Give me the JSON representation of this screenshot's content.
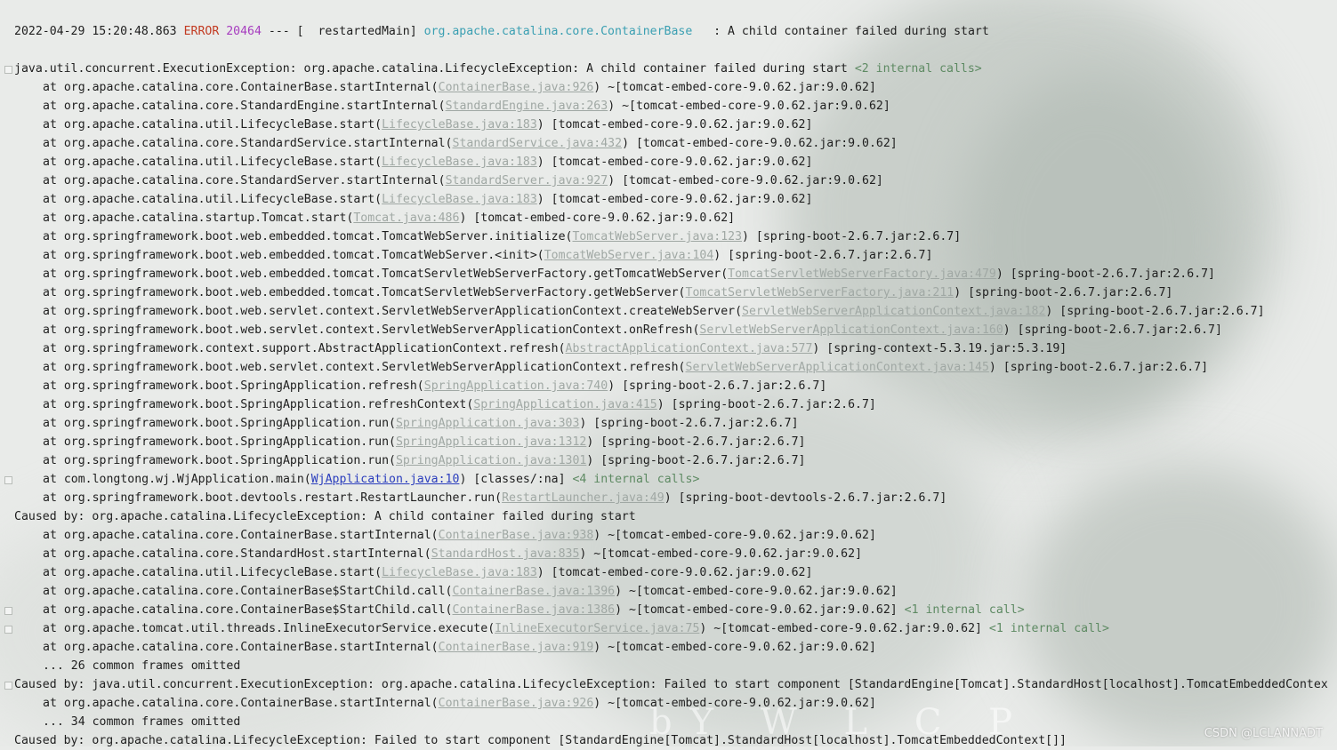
{
  "header_line": {
    "timestamp": "2022-04-29 15:20:48.863",
    "level": "ERROR",
    "pid": "20464",
    "sep": "---",
    "thread": "[  restartedMain]",
    "logger": "org.apache.catalina.core.ContainerBase",
    "message": ": A child container failed during start"
  },
  "stack_lines": [
    {
      "text": "java.util.concurrent.ExecutionException: org.apache.catalina.LifecycleException: A child container failed during start ",
      "internal": "<2 internal calls>",
      "fold": true
    },
    {
      "text": "at org.apache.catalina.core.ContainerBase.startInternal(",
      "link": "ContainerBase.java:926",
      "tail": ") ~[tomcat-embed-core-9.0.62.jar:9.0.62]",
      "indent": true
    },
    {
      "text": "at org.apache.catalina.core.StandardEngine.startInternal(",
      "link": "StandardEngine.java:263",
      "tail": ") ~[tomcat-embed-core-9.0.62.jar:9.0.62]",
      "indent": true
    },
    {
      "text": "at org.apache.catalina.util.LifecycleBase.start(",
      "link": "LifecycleBase.java:183",
      "tail": ") [tomcat-embed-core-9.0.62.jar:9.0.62]",
      "indent": true
    },
    {
      "text": "at org.apache.catalina.core.StandardService.startInternal(",
      "link": "StandardService.java:432",
      "tail": ") [tomcat-embed-core-9.0.62.jar:9.0.62]",
      "indent": true
    },
    {
      "text": "at org.apache.catalina.util.LifecycleBase.start(",
      "link": "LifecycleBase.java:183",
      "tail": ") [tomcat-embed-core-9.0.62.jar:9.0.62]",
      "indent": true
    },
    {
      "text": "at org.apache.catalina.core.StandardServer.startInternal(",
      "link": "StandardServer.java:927",
      "tail": ") [tomcat-embed-core-9.0.62.jar:9.0.62]",
      "indent": true
    },
    {
      "text": "at org.apache.catalina.util.LifecycleBase.start(",
      "link": "LifecycleBase.java:183",
      "tail": ") [tomcat-embed-core-9.0.62.jar:9.0.62]",
      "indent": true
    },
    {
      "text": "at org.apache.catalina.startup.Tomcat.start(",
      "link": "Tomcat.java:486",
      "tail": ") [tomcat-embed-core-9.0.62.jar:9.0.62]",
      "indent": true
    },
    {
      "text": "at org.springframework.boot.web.embedded.tomcat.TomcatWebServer.initialize(",
      "link": "TomcatWebServer.java:123",
      "tail": ") [spring-boot-2.6.7.jar:2.6.7]",
      "indent": true
    },
    {
      "text": "at org.springframework.boot.web.embedded.tomcat.TomcatWebServer.<init>(",
      "link": "TomcatWebServer.java:104",
      "tail": ") [spring-boot-2.6.7.jar:2.6.7]",
      "indent": true
    },
    {
      "text": "at org.springframework.boot.web.embedded.tomcat.TomcatServletWebServerFactory.getTomcatWebServer(",
      "link": "TomcatServletWebServerFactory.java:479",
      "tail": ") [spring-boot-2.6.7.jar:2.6.7]",
      "indent": true
    },
    {
      "text": "at org.springframework.boot.web.embedded.tomcat.TomcatServletWebServerFactory.getWebServer(",
      "link": "TomcatServletWebServerFactory.java:211",
      "tail": ") [spring-boot-2.6.7.jar:2.6.7]",
      "indent": true
    },
    {
      "text": "at org.springframework.boot.web.servlet.context.ServletWebServerApplicationContext.createWebServer(",
      "link": "ServletWebServerApplicationContext.java:182",
      "tail": ") [spring-boot-2.6.7.jar:2.6.7]",
      "indent": true
    },
    {
      "text": "at org.springframework.boot.web.servlet.context.ServletWebServerApplicationContext.onRefresh(",
      "link": "ServletWebServerApplicationContext.java:160",
      "tail": ") [spring-boot-2.6.7.jar:2.6.7]",
      "indent": true
    },
    {
      "text": "at org.springframework.context.support.AbstractApplicationContext.refresh(",
      "link": "AbstractApplicationContext.java:577",
      "tail": ") [spring-context-5.3.19.jar:5.3.19]",
      "indent": true
    },
    {
      "text": "at org.springframework.boot.web.servlet.context.ServletWebServerApplicationContext.refresh(",
      "link": "ServletWebServerApplicationContext.java:145",
      "tail": ") [spring-boot-2.6.7.jar:2.6.7]",
      "indent": true
    },
    {
      "text": "at org.springframework.boot.SpringApplication.refresh(",
      "link": "SpringApplication.java:740",
      "tail": ") [spring-boot-2.6.7.jar:2.6.7]",
      "indent": true
    },
    {
      "text": "at org.springframework.boot.SpringApplication.refreshContext(",
      "link": "SpringApplication.java:415",
      "tail": ") [spring-boot-2.6.7.jar:2.6.7]",
      "indent": true
    },
    {
      "text": "at org.springframework.boot.SpringApplication.run(",
      "link": "SpringApplication.java:303",
      "tail": ") [spring-boot-2.6.7.jar:2.6.7]",
      "indent": true
    },
    {
      "text": "at org.springframework.boot.SpringApplication.run(",
      "link": "SpringApplication.java:1312",
      "tail": ") [spring-boot-2.6.7.jar:2.6.7]",
      "indent": true
    },
    {
      "text": "at org.springframework.boot.SpringApplication.run(",
      "link": "SpringApplication.java:1301",
      "tail": ") [spring-boot-2.6.7.jar:2.6.7]",
      "indent": true
    },
    {
      "text": "at com.longtong.wj.WjApplication.main(",
      "link": "WjApplication.java:10",
      "user_link": true,
      "tail": ") [classes/:na] ",
      "internal": "<4 internal calls>",
      "indent": true,
      "fold": true
    },
    {
      "text": "at org.springframework.boot.devtools.restart.RestartLauncher.run(",
      "link": "RestartLauncher.java:49",
      "tail": ") [spring-boot-devtools-2.6.7.jar:2.6.7]",
      "indent": true
    },
    {
      "text": "Caused by: org.apache.catalina.LifecycleException: A child container failed during start"
    },
    {
      "text": "at org.apache.catalina.core.ContainerBase.startInternal(",
      "link": "ContainerBase.java:938",
      "tail": ") ~[tomcat-embed-core-9.0.62.jar:9.0.62]",
      "indent": true
    },
    {
      "text": "at org.apache.catalina.core.StandardHost.startInternal(",
      "link": "StandardHost.java:835",
      "tail": ") ~[tomcat-embed-core-9.0.62.jar:9.0.62]",
      "indent": true
    },
    {
      "text": "at org.apache.catalina.util.LifecycleBase.start(",
      "link": "LifecycleBase.java:183",
      "tail": ") [tomcat-embed-core-9.0.62.jar:9.0.62]",
      "indent": true
    },
    {
      "text": "at org.apache.catalina.core.ContainerBase$StartChild.call(",
      "link": "ContainerBase.java:1396",
      "tail": ") ~[tomcat-embed-core-9.0.62.jar:9.0.62]",
      "indent": true
    },
    {
      "text": "at org.apache.catalina.core.ContainerBase$StartChild.call(",
      "link": "ContainerBase.java:1386",
      "tail": ") ~[tomcat-embed-core-9.0.62.jar:9.0.62] ",
      "internal": "<1 internal call>",
      "indent": true,
      "fold": true
    },
    {
      "text": "at org.apache.tomcat.util.threads.InlineExecutorService.execute(",
      "link": "InlineExecutorService.java:75",
      "tail": ") ~[tomcat-embed-core-9.0.62.jar:9.0.62] ",
      "internal": "<1 internal call>",
      "indent": true,
      "fold": true
    },
    {
      "text": "at org.apache.catalina.core.ContainerBase.startInternal(",
      "link": "ContainerBase.java:919",
      "tail": ") ~[tomcat-embed-core-9.0.62.jar:9.0.62]",
      "indent": true
    },
    {
      "text": "... 26 common frames omitted",
      "indent": true
    },
    {
      "text": "Caused by: java.util.concurrent.ExecutionException: org.apache.catalina.LifecycleException: Failed to start component [StandardEngine[Tomcat].StandardHost[localhost].TomcatEmbeddedContex",
      "fold": true
    },
    {
      "text": "at org.apache.catalina.core.ContainerBase.startInternal(",
      "link": "ContainerBase.java:926",
      "tail": ") ~[tomcat-embed-core-9.0.62.jar:9.0.62]",
      "indent": true
    },
    {
      "text": "... 34 common frames omitted",
      "indent": true
    },
    {
      "text": "Caused by: org.apache.catalina.LifecycleException: Failed to start component [StandardEngine[Tomcat].StandardHost[localhost].TomcatEmbeddedContext[]]"
    }
  ],
  "watermark": "CSDN @LCLANNADT",
  "background_text": "bY W L C P",
  "colors": {
    "error": "#c23b22",
    "pid": "#a63cbf",
    "logger": "#3a9fb2",
    "link": "#a0a8a4",
    "user_link": "#2a3dbd",
    "internal_calls": "#5e8a63"
  }
}
